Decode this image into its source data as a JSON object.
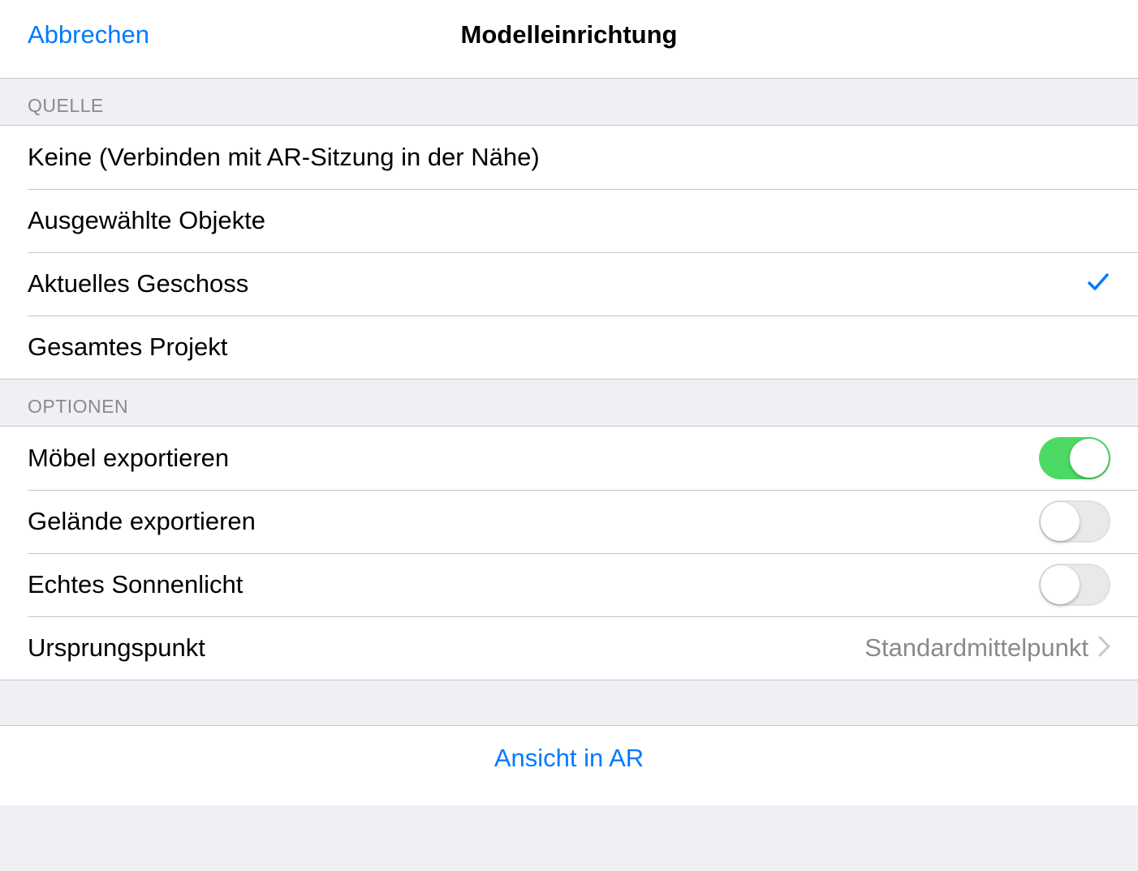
{
  "navbar": {
    "cancel": "Abbrechen",
    "title": "Modelleinrichtung"
  },
  "sections": {
    "source": {
      "header": "Quelle",
      "items": {
        "none": "Keine (Verbinden mit AR-Sitzung in der Nähe)",
        "selected_objects": "Ausgewählte Objekte",
        "current_floor": "Aktuelles Geschoss",
        "whole_project": "Gesamtes Projekt"
      },
      "selected": "current_floor"
    },
    "options": {
      "header": "Optionen",
      "export_furniture": {
        "label": "Möbel exportieren",
        "on": true
      },
      "export_terrain": {
        "label": "Gelände exportieren",
        "on": false
      },
      "real_sunlight": {
        "label": "Echtes Sonnenlicht",
        "on": false
      },
      "origin_point": {
        "label": "Ursprungspunkt",
        "value": "Standardmittelpunkt"
      }
    }
  },
  "footer": {
    "view_in_ar": "Ansicht in AR"
  }
}
